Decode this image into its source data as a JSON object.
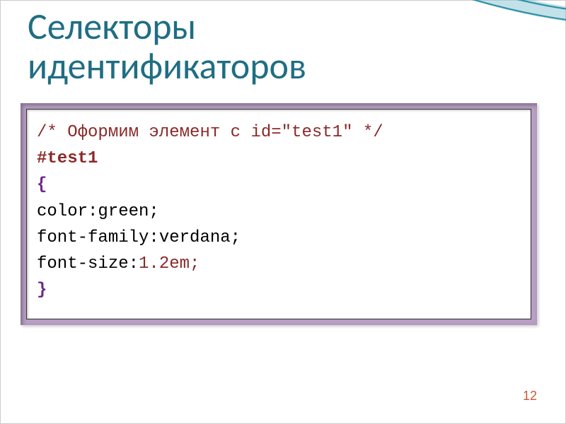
{
  "title_line1": "Селекторы",
  "title_line2": "идентификаторов",
  "code": {
    "comment": "/* Оформим элемент с id=\"test1\" */",
    "selector": "#test1",
    "brace_open": "{",
    "line1_prop": "color:",
    "line1_val": "green;",
    "line2_prop": "font-family:",
    "line2_val": "verdana;",
    "line3_prop": "font-size:",
    "line3_val": "1.2em;",
    "brace_close": "}"
  },
  "page_number": "12"
}
